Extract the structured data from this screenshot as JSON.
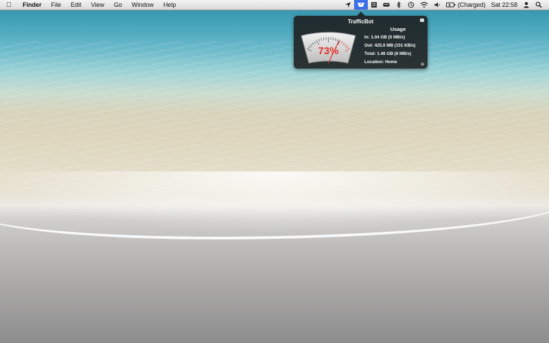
{
  "menubar": {
    "app_name": "Finder",
    "menus": [
      "File",
      "Edit",
      "View",
      "Go",
      "Window",
      "Help"
    ],
    "status": {
      "battery_label": "(Charged)",
      "clock": "Sat 22:58"
    }
  },
  "popover": {
    "title": "TrafficBot",
    "gauge_value": "73%",
    "usage_fraction": 0.73,
    "heading": "Usage",
    "in": "In: 1.04 GB (5 MB/s)",
    "out": "Out: 425.0 MB (151 KB/s)",
    "total": "Total: 1.46 GB (6 MB/s)",
    "location": "Location: Home"
  },
  "colors": {
    "gauge_text": "#e5322d",
    "active_status": "#3b6ee8"
  }
}
